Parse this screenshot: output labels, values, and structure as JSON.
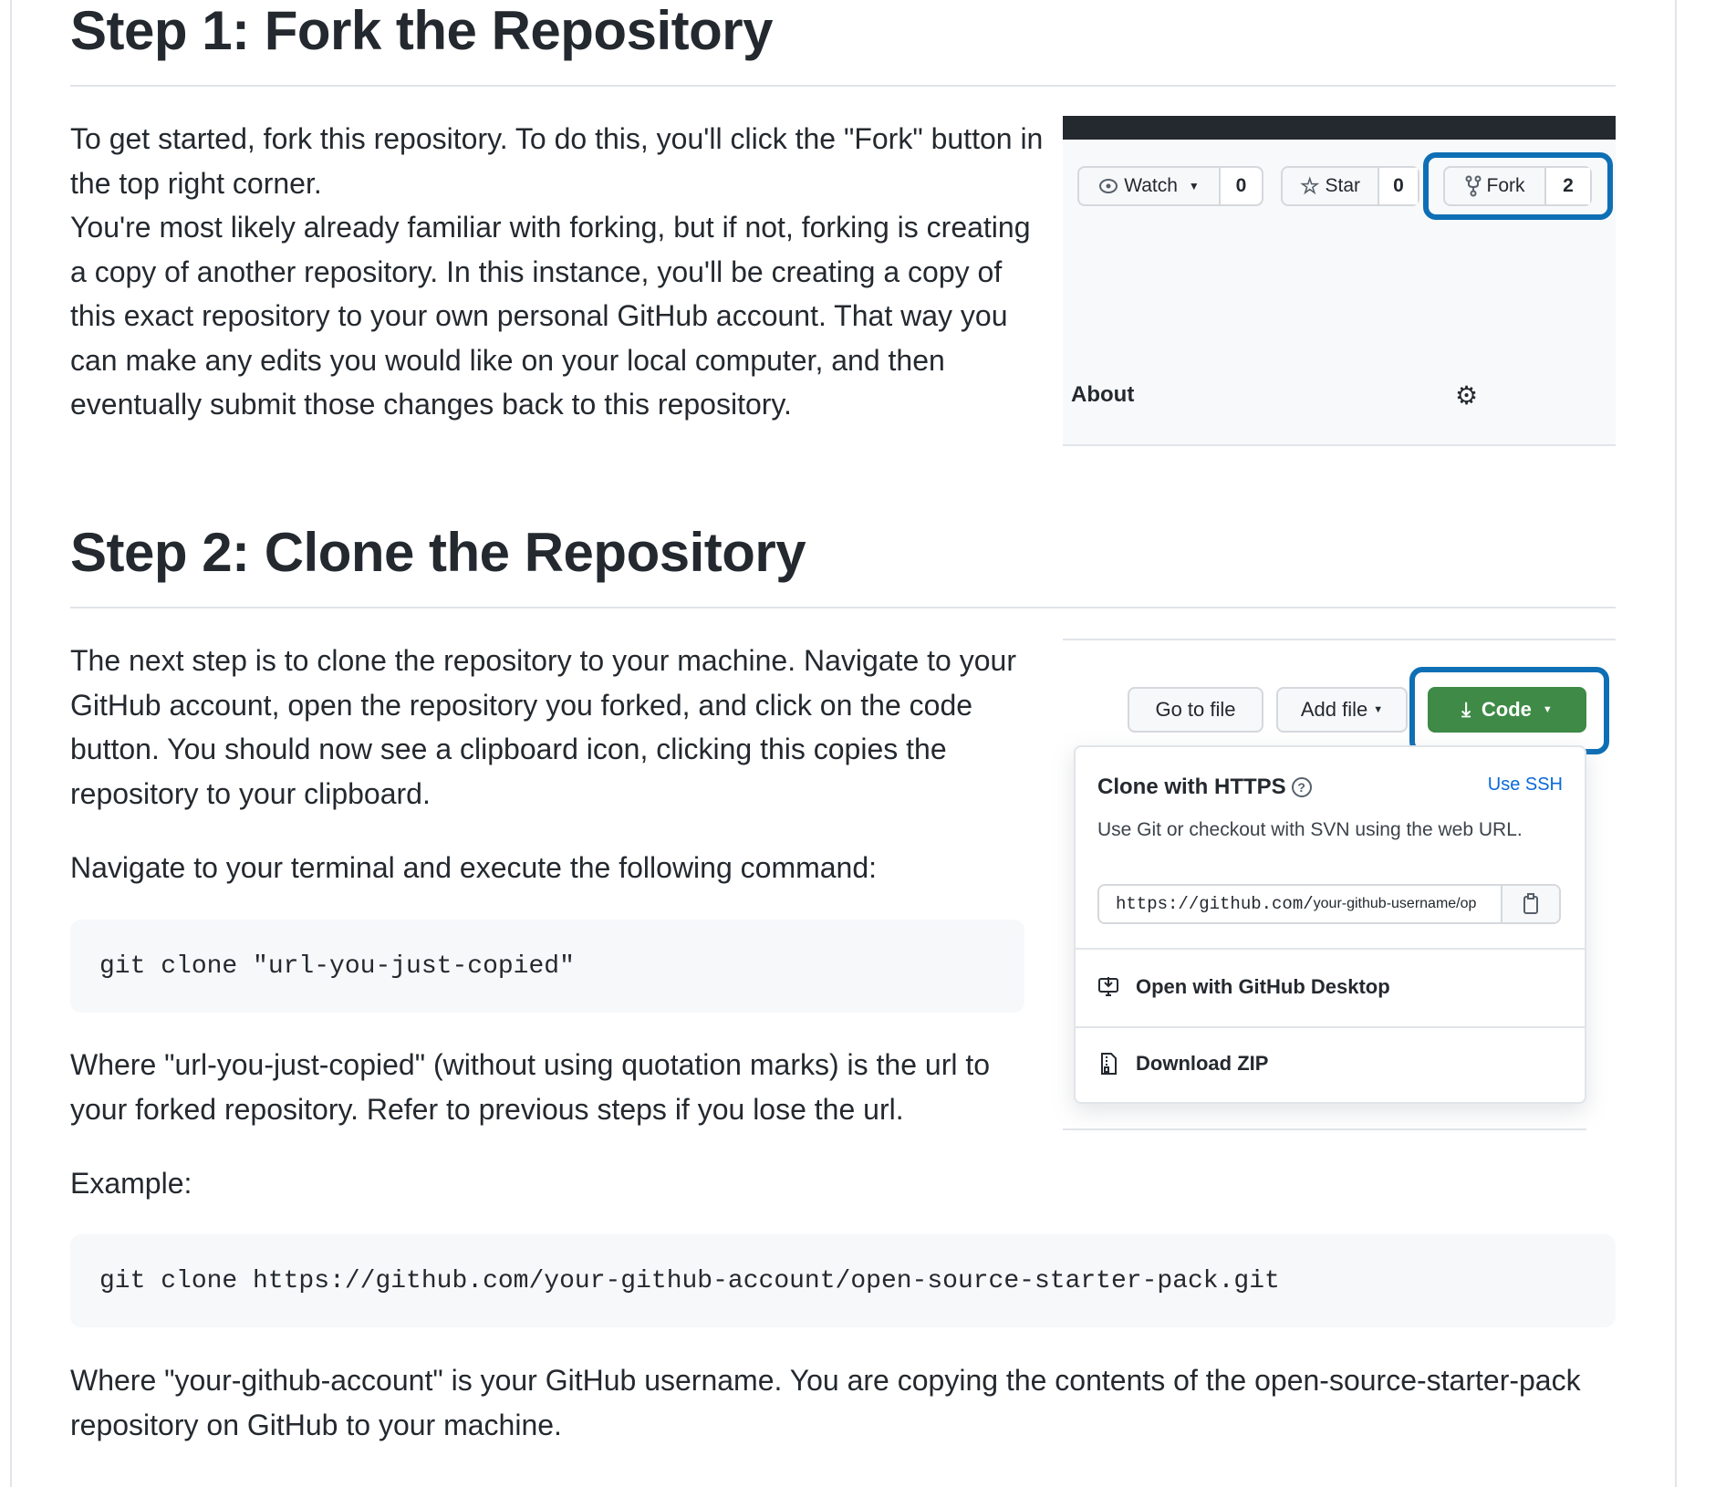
{
  "step1": {
    "heading": "Step 1: Fork the Repository",
    "paragraph": "To get started, fork this repository. To do this, you'll click the \"Fork\" button in the top right corner.",
    "paragraph2": "You're most likely already familiar with forking, but if not, forking is creating a copy of another repository. In this instance, you'll be creating a copy of this exact repository to your own personal GitHub account. That way you can make any edits you would like on your local computer, and then eventually submit those changes back to this repository.",
    "screenshot": {
      "watch_label": "Watch",
      "watch_count": "0",
      "star_label": "Star",
      "star_count": "0",
      "fork_label": "Fork",
      "fork_count": "2",
      "about_label": "About"
    }
  },
  "step2": {
    "heading": "Step 2: Clone the Repository",
    "paragraph": "The next step is to clone the repository to your machine. Navigate to your GitHub account, open the repository you forked, and click on the code button. You should now see a clipboard icon, clicking this copies the repository to your clipboard.",
    "navigate": "Navigate to your terminal and execute the following command:",
    "command": "git clone \"url-you-just-copied\"",
    "where": "Where \"url-you-just-copied\" (without using quotation marks) is the url to your forked repository. Refer to previous steps if you lose the url.",
    "example_label": "Example:",
    "example_command": "git clone https://github.com/your-github-account/open-source-starter-pack.git",
    "final": "Where \"your-github-account\" is your GitHub username. You are copying the contents of the open-source-starter-pack repository on GitHub to your machine.",
    "screenshot": {
      "go_to_file": "Go to file",
      "add_file": "Add file",
      "code": "Code",
      "clone_title": "Clone with HTTPS",
      "use_ssh": "Use SSH",
      "clone_desc": "Use Git or checkout with SVN using the web URL.",
      "url_prefix": "https://github.com/",
      "url_rest": "your-github-username/op",
      "open_desktop": "Open with GitHub Desktop",
      "download_zip": "Download ZIP"
    }
  },
  "colors": {
    "highlight": "#0f6fb5",
    "code_green": "#3e8a46",
    "link": "#0969da"
  }
}
